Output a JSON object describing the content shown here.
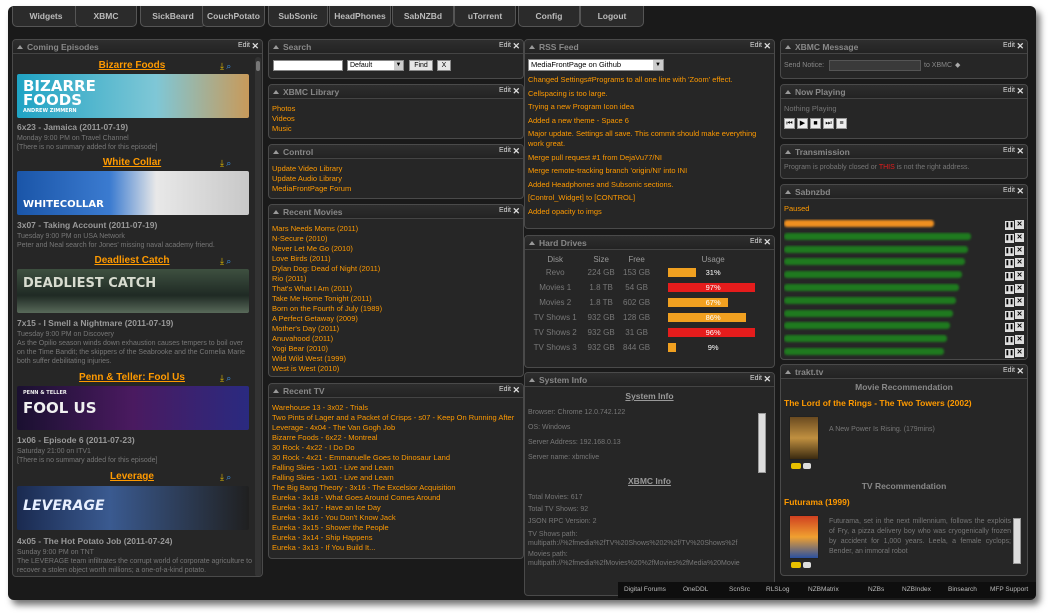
{
  "nav": [
    "Widgets",
    "XBMC",
    "SickBeard",
    "CouchPotato",
    "SubSonic",
    "HeadPhones",
    "SabNZBd",
    "uTorrent",
    "Config",
    "Logout"
  ],
  "common": {
    "edit": "Edit",
    "close": "✕"
  },
  "coming": {
    "title": "Coming Episodes",
    "episodes": [
      {
        "show": "Bizarre Foods",
        "banner": "BIZARRE FOODS",
        "banner_sub": "ANDREW ZIMMERN",
        "ep": "6x23 - Jamaica (2011-07-19)",
        "air": "Monday 9:00 PM on Travel Channel",
        "sum": "[There is no summary added for this episode]"
      },
      {
        "show": "White Collar",
        "banner": "WHITECOLLAR",
        "banner_sub": "",
        "ep": "3x07 - Taking Account (2011-07-19)",
        "air": "Tuesday 9:00 PM on USA Network",
        "sum": "Peter and Neal search for Jones' missing naval academy friend."
      },
      {
        "show": "Deadliest Catch",
        "banner": "DEADLIEST CATCH",
        "banner_sub": "",
        "ep": "7x15 - I Smell a Nightmare (2011-07-19)",
        "air": "Tuesday 9:00 PM on Discovery",
        "sum": "As the Opilio season winds down exhaustion causes tempers to boil over on the Time Bandit; the skippers of the Seabrooke and the Cornelia Marie both suffer debilitating injuries."
      },
      {
        "show": "Penn & Teller: Fool Us",
        "banner": "FOOL US",
        "banner_sub": "PENN & TELLER",
        "ep": "1x06 - Episode 6 (2011-07-23)",
        "air": "Saturday 21:00 on ITV1",
        "sum": "[There is no summary added for this episode]"
      },
      {
        "show": "Leverage",
        "banner": "LEVERAGE",
        "banner_sub": "",
        "ep": "4x05 - The Hot Potato Job (2011-07-24)",
        "air": "Sunday 9:00 PM on TNT",
        "sum": "The LEVERAGE team infiltrates the corrupt world of corporate agriculture to recover a stolen object worth millions; a one-of-a-kind potato."
      }
    ]
  },
  "search": {
    "title": "Search",
    "select": "Default",
    "find": "Find",
    "clear": "X"
  },
  "library": {
    "title": "XBMC Library",
    "items": [
      "Photos",
      "Videos",
      "Music"
    ]
  },
  "control": {
    "title": "Control",
    "items": [
      "Update Video Library",
      "Update Audio Library",
      "MediaFrontPage Forum"
    ]
  },
  "recent_movies": {
    "title": "Recent Movies",
    "items": [
      "Mars Needs Moms  (2011)",
      "N-Secure  (2010)",
      "Never Let Me Go  (2010)",
      "Love Birds  (2011)",
      "Dylan Dog: Dead of Night  (2011)",
      "Rio  (2011)",
      "That's What I Am  (2011)",
      "Take Me Home Tonight  (2011)",
      "Born on the Fourth of July  (1989)",
      "A Perfect Getaway  (2009)",
      "Mother's Day  (2011)",
      "Anuvahood  (2011)",
      "Yogi Bear  (2010)",
      "Wild Wild West  (1999)",
      "West is West  (2010)"
    ]
  },
  "recent_tv": {
    "title": "Recent TV",
    "items": [
      "Warehouse 13 - 3x02 - Trials",
      "Two Pints of Lager and a Packet of Crisps - s07 - Keep On Running After",
      "Leverage - 4x04 - The Van Gogh Job",
      "Bizarre Foods - 6x22 - Montreal",
      "30 Rock - 4x22 - I Do Do",
      "30 Rock - 4x21 - Emmanuelle Goes to Dinosaur Land",
      "Falling Skies - 1x01 - Live and Learn",
      "Falling Skies - 1x01 - Live and Learn",
      "The Big Bang Theory - 3x16 - The Excelsior Acquisition",
      "Eureka - 3x18 - What Goes Around Comes Around",
      "Eureka - 3x17 - Have an Ice Day",
      "Eureka - 3x16 - You Don't Know Jack",
      "Eureka - 3x15 - Shower the People",
      "Eureka - 3x14 - Ship Happens",
      "Eureka - 3x13 - If You Build It..."
    ]
  },
  "rss": {
    "title": "RSS Feed",
    "select": "MediaFrontPage on Github",
    "items": [
      "Changed Settings#Programs to all one line with 'Zoom' effect.",
      "Cellspacing is too large.",
      "Trying a new Program Icon idea",
      "Added a new theme - Space 6",
      "Major update. Settings all save. This commit should make everything work great.",
      "Merge pull request #1 from DejaVu77/NI",
      "Merge remote-tracking branch 'origin/NI' into INI",
      "Added Headphones and Subsonic sections.",
      "[Control_Widget] to [CONTROL]",
      "Added opacity to imgs"
    ]
  },
  "drives": {
    "title": "Hard Drives",
    "headers": [
      "Disk",
      "Size",
      "Free",
      "Usage"
    ],
    "rows": [
      {
        "disk": "Revo",
        "size": "224 GB",
        "free": "153 GB",
        "usage": "31%",
        "pct": 31,
        "color": "#f0a020"
      },
      {
        "disk": "Movies 1",
        "size": "1.8 TB",
        "free": "54 GB",
        "usage": "97%",
        "pct": 97,
        "color": "#e51c1c"
      },
      {
        "disk": "Movies 2",
        "size": "1.8 TB",
        "free": "602 GB",
        "usage": "67%",
        "pct": 67,
        "color": "#f0a020"
      },
      {
        "disk": "TV Shows 1",
        "size": "932 GB",
        "free": "128 GB",
        "usage": "86%",
        "pct": 86,
        "color": "#f0a020"
      },
      {
        "disk": "TV Shows 2",
        "size": "932 GB",
        "free": "31 GB",
        "usage": "96%",
        "pct": 96,
        "color": "#e51c1c"
      },
      {
        "disk": "TV Shows 3",
        "size": "932 GB",
        "free": "844 GB",
        "usage": "9%",
        "pct": 9,
        "color": "#f0a020"
      }
    ]
  },
  "sysinfo": {
    "title": "System Info",
    "sub1": "System Info",
    "sub2": "XBMC Info",
    "lines": [
      "Browser: Chrome 12.0.742.122",
      "OS: Windows",
      "Server Address: 192.168.0.13",
      "Server name: xbmclive"
    ],
    "xbmc_lines": [
      "Total Movies: 617",
      "Total TV Shows: 92",
      "JSON RPC Version: 2",
      "TV Shows path: multipath://%2fmedia%2fTV%20Shows%202%2f/TV%20Shows%2f",
      "Movies path: multipath://%2fmedia%2fMovies%20%2fMovies%2fMedia%20Movie"
    ]
  },
  "xbmc_msg": {
    "title": "XBMC Message",
    "send_label": "Send Notice:",
    "to_label": "to XBMC"
  },
  "now_playing": {
    "title": "Now Playing",
    "status": "Nothing Playing"
  },
  "transmission": {
    "title": "Transmission",
    "msg_pre": "Program is probably closed or ",
    "msg_link": "THIS",
    "msg_post": " is not the right address."
  },
  "sab": {
    "title": "Sabnzbd",
    "status": "Paused",
    "rows": 11
  },
  "trakt": {
    "title": "trakt.tv",
    "movie_head": "Movie Recommendation",
    "movie_title": "The Lord of the Rings - The Two Towers (2002)",
    "movie_tag": "A New Power Is Rising. (179mins)",
    "tv_head": "TV Recommendation",
    "tv_title": "Futurama (1999)",
    "tv_desc": "Futurama, set in the next millennium, follows the exploits of Fry, a pizza delivery boy who was cryogenically frozen by accident for 1,000 years. Leela, a female cyclops; Bender, an immoral robot"
  },
  "footer": [
    "Digital Forums",
    "OneDDL",
    "ScnSrc",
    "RLSLog",
    "NZBMatrix",
    "NZBs",
    "NZBIndex",
    "Binsearch",
    "MFP Support"
  ]
}
